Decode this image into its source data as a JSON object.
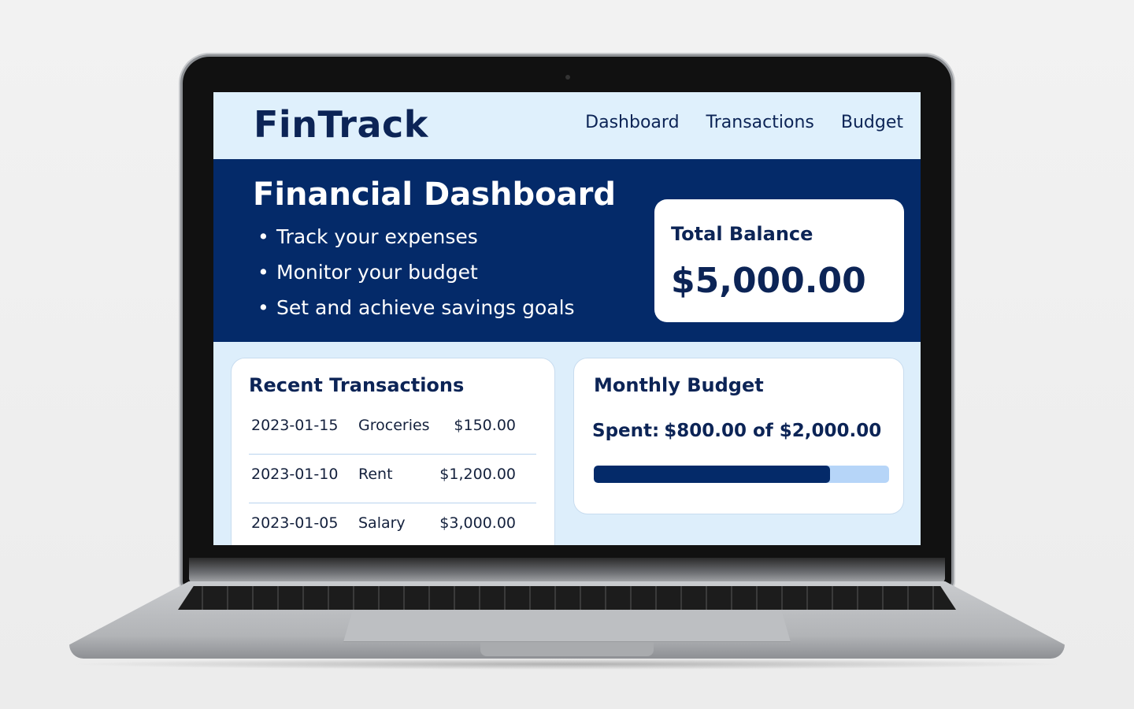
{
  "app": {
    "brand": "FinTrack"
  },
  "nav": {
    "items": [
      {
        "label": "Dashboard"
      },
      {
        "label": "Transactions"
      },
      {
        "label": "Budget"
      }
    ]
  },
  "hero": {
    "title": "Financial Dashboard",
    "bullets": [
      "Track your expenses",
      "Monitor your budget",
      "Set and achieve savings goals"
    ]
  },
  "balance": {
    "label": "Total Balance",
    "value": "$5,000.00"
  },
  "transactions": {
    "title": "Recent Transactions",
    "rows": [
      {
        "date": "2023-01-15",
        "category": "Groceries",
        "amount": "$150.00"
      },
      {
        "date": "2023-01-10",
        "category": "Rent",
        "amount": "$1,200.00"
      },
      {
        "date": "2023-01-05",
        "category": "Salary",
        "amount": "$3,000.00"
      }
    ]
  },
  "budget": {
    "title": "Monthly Budget",
    "spent_prefix": "Spent:",
    "spent_text": "$800.00 of $2,000.00",
    "progress_fraction": 0.8
  },
  "colors": {
    "navy": "#042a69",
    "light_blue": "#ddeefb",
    "progress_track": "#b6d5f8"
  }
}
